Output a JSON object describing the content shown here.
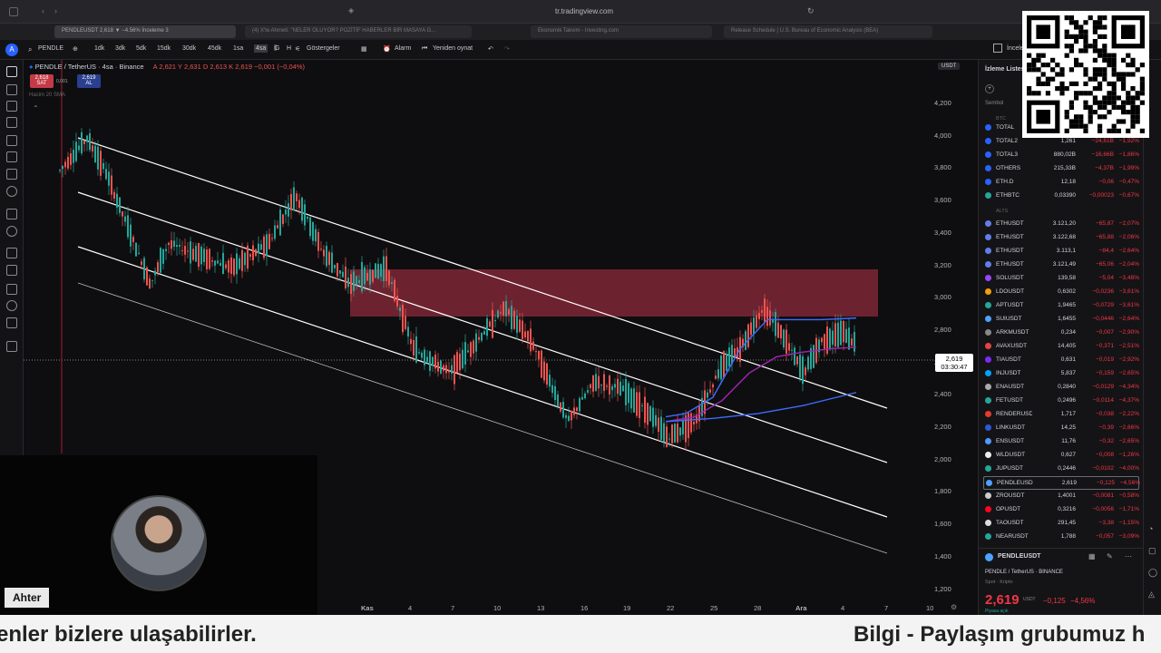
{
  "browser": {
    "url": "tr.tradingview.com",
    "tabs": [
      "PENDLEUSDT 2,618 ▼ −4.56% İnceleme 3",
      "(4) X'te Ahmeti: \"NELER OLUYOR? POZİTİF HABERLER BİR MASAYA G...",
      "Ekonomik Takvim - Investing.com",
      "Release Schedule | U.S. Bureau of Economic Analysis (BEA)"
    ]
  },
  "toolbar": {
    "symbol": "PENDLE",
    "intervals": [
      "1dk",
      "3dk",
      "5dk",
      "15dk",
      "30dk",
      "45dk",
      "1sa",
      "4sa",
      "G",
      "H"
    ],
    "active_interval": "4sa",
    "indicators": "Göstergeler",
    "alarm": "Alarm",
    "replay": "Yeniden oynat",
    "watchlist_title": "İnceleme"
  },
  "legend": {
    "title": "PENDLE / TetherUS · 4sa · Binance",
    "ohlc": "A 2,621  Y 2,631  D 2,613  K 2,619  −0,001 (−0,04%)",
    "sell_price": "2,618",
    "sell_label": "SAT",
    "spread": "0,001",
    "buy_price": "2,619",
    "buy_label": "AL",
    "volume": "Hacim 20 SMA"
  },
  "chart": {
    "currency": "USDT",
    "current_price": "2,619",
    "countdown": "03:30:47",
    "y_ticks": [
      "4,200",
      "4,000",
      "3,800",
      "3,600",
      "3,400",
      "3,200",
      "3,000",
      "2,800",
      "2,600",
      "2,400",
      "2,200",
      "2,000",
      "1,800",
      "1,600",
      "1,400",
      "1,200"
    ],
    "x_ticks": [
      "Kas",
      "4",
      "7",
      "10",
      "13",
      "16",
      "19",
      "22",
      "25",
      "28",
      "Ara",
      "4",
      "7",
      "10"
    ],
    "colors": {
      "bull": "#26a69a",
      "bear": "#ef5350",
      "zone": "#8e2a3a",
      "channel": "#ffffff"
    }
  },
  "watchlist": {
    "header": "İzleme Listesi",
    "col_symbol": "Sembol",
    "section_btc": "BTC",
    "section_alts": "ALTS",
    "rows_btc": [
      {
        "sym": "TOTAL",
        "last": "",
        "chg": "",
        "pct": "",
        "color": "#2962ff"
      },
      {
        "sym": "TOTAL2",
        "last": "1,261",
        "chg": "−24,61B",
        "pct": "−1,92%",
        "color": "#2962ff"
      },
      {
        "sym": "TOTAL3",
        "last": "880,02B",
        "chg": "−16,66B",
        "pct": "−1,86%",
        "color": "#2962ff"
      },
      {
        "sym": "OTHERS",
        "last": "215,33B",
        "chg": "−4,37B",
        "pct": "−1,99%",
        "color": "#2962ff"
      },
      {
        "sym": "ETH.D",
        "last": "12,18",
        "chg": "−0,06",
        "pct": "−0,47%",
        "color": "#2962ff"
      },
      {
        "sym": "ETHBTC",
        "last": "0,03390",
        "chg": "−0,00023",
        "pct": "−0,67%",
        "color": "#26a69a"
      }
    ],
    "rows_alts": [
      {
        "sym": "ETHUSDT",
        "last": "3.121,20",
        "chg": "−65,87",
        "pct": "−2,07%",
        "color": "#627eea"
      },
      {
        "sym": "ETHUSDT",
        "last": "3.122,68",
        "chg": "−65,88",
        "pct": "−2,06%",
        "color": "#627eea"
      },
      {
        "sym": "ETHUSDT",
        "last": "3.113,1",
        "chg": "−84,4",
        "pct": "−2,64%",
        "color": "#627eea"
      },
      {
        "sym": "ETHUSDT",
        "last": "3.121,49",
        "chg": "−65,06",
        "pct": "−2,04%",
        "color": "#627eea"
      },
      {
        "sym": "SOLUSDT",
        "last": "139,58",
        "chg": "−5,04",
        "pct": "−3,48%",
        "color": "#9945ff"
      },
      {
        "sym": "LDOUSDT",
        "last": "0,6302",
        "chg": "−0,0236",
        "pct": "−3,61%",
        "color": "#f59e0b"
      },
      {
        "sym": "APTUSDT",
        "last": "1,9465",
        "chg": "−0,0729",
        "pct": "−3,61%",
        "color": "#26a69a"
      },
      {
        "sym": "SUIUSDT",
        "last": "1,6455",
        "chg": "−0,0446",
        "pct": "−2,64%",
        "color": "#4da2ff"
      },
      {
        "sym": "ARKMUSDT",
        "last": "0,234",
        "chg": "−0,007",
        "pct": "−2,90%",
        "color": "#888888"
      },
      {
        "sym": "AVAXUSDT",
        "last": "14,405",
        "chg": "−0,371",
        "pct": "−2,51%",
        "color": "#e84142"
      },
      {
        "sym": "TIAUSDT",
        "last": "0,631",
        "chg": "−0,019",
        "pct": "−2,92%",
        "color": "#7b2bf9"
      },
      {
        "sym": "INJUSDT",
        "last": "5,837",
        "chg": "−0,159",
        "pct": "−2,65%",
        "color": "#00a3ff"
      },
      {
        "sym": "ENAUSDT",
        "last": "0,2840",
        "chg": "−0,0129",
        "pct": "−4,34%",
        "color": "#aaaaaa"
      },
      {
        "sym": "FETUSDT",
        "last": "0,2496",
        "chg": "−0,0114",
        "pct": "−4,37%",
        "color": "#26a69a"
      },
      {
        "sym": "RENDERUSDT",
        "last": "1,717",
        "chg": "−0,038",
        "pct": "−2,22%",
        "color": "#e33b2e"
      },
      {
        "sym": "LINKUSDT",
        "last": "14,25",
        "chg": "−0,39",
        "pct": "−2,66%",
        "color": "#2a5ada"
      },
      {
        "sym": "ENSUSDT",
        "last": "11,76",
        "chg": "−0,32",
        "pct": "−2,65%",
        "color": "#5298ff"
      },
      {
        "sym": "WLDUSDT",
        "last": "0,627",
        "chg": "−0,008",
        "pct": "−1,26%",
        "color": "#eeeeee"
      },
      {
        "sym": "JUPUSDT",
        "last": "0,2446",
        "chg": "−0,0102",
        "pct": "−4,00%",
        "color": "#26a69a"
      },
      {
        "sym": "PENDLEUSDT",
        "last": "2,619",
        "chg": "−0,125",
        "pct": "−4,56%",
        "color": "#4da2ff"
      },
      {
        "sym": "ZROUSDT",
        "last": "1,4001",
        "chg": "−0,0081",
        "pct": "−0,58%",
        "color": "#cccccc"
      },
      {
        "sym": "OPUSDT",
        "last": "0,3216",
        "chg": "−0,0056",
        "pct": "−1,71%",
        "color": "#ff0420"
      },
      {
        "sym": "TAOUSDT",
        "last": "291,45",
        "chg": "−3,38",
        "pct": "−1,15%",
        "color": "#dddddd"
      },
      {
        "sym": "NEARUSDT",
        "last": "1,788",
        "chg": "−0,057",
        "pct": "−3,09%",
        "color": "#26a69a"
      }
    ]
  },
  "details": {
    "symbol": "PENDLEUSDT",
    "name": "PENDLE / TetherUS · BINANCE",
    "category": "Spot · Kripto",
    "price": "2,619",
    "currency": "USDT",
    "change": "−0,125",
    "pct": "−4,56%",
    "status": "Piyasa açık"
  },
  "overlay": {
    "speaker": "Ahter",
    "ticker_left": "enler bizlere ulaşabilirler.",
    "ticker_right": "Bilgi - Paylaşım grubumuz h"
  }
}
